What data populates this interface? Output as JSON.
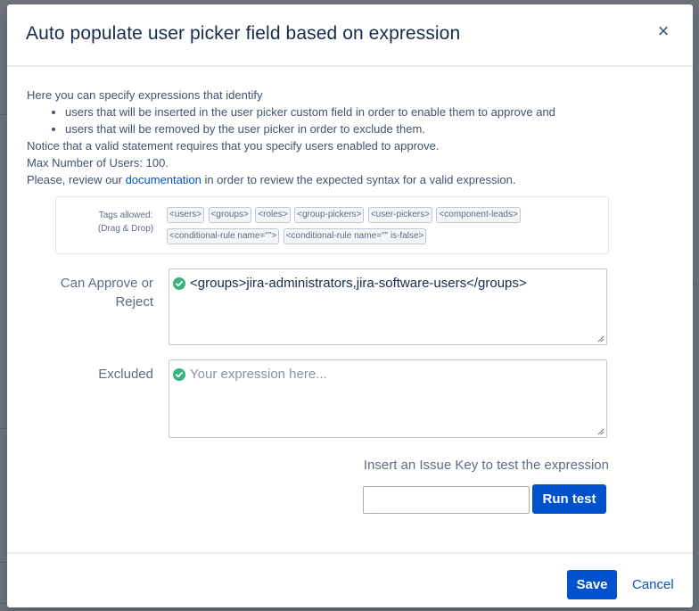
{
  "dialog": {
    "title": "Auto populate user picker field based on expression",
    "close_label": "×"
  },
  "intro": {
    "line1": "Here you can specify expressions that identify",
    "bullets": [
      "users that will be inserted in the user picker custom field in order to enable them to approve and",
      "users that will be removed by the user picker in order to exclude them."
    ],
    "line2": "Notice that a valid statement requires that you specify users enabled to approve.",
    "line3": "Max Number of Users: 100.",
    "line4_before": "Please, review our ",
    "line4_link": "documentation",
    "line4_after": " in order to review the expected syntax for a valid expression."
  },
  "tags": {
    "label_line1": "Tags allowed:",
    "label_line2": "(Drag & Drop)",
    "items": [
      "<users>",
      "<groups>",
      "<roles>",
      "<group-pickers>",
      "<user-pickers>",
      "<component-leads>",
      "<conditional-rule name=\"\">",
      "<conditional-rule name=\"\" is-false>"
    ]
  },
  "approve_field": {
    "label_line1": "Can Approve or",
    "label_line2": "Reject",
    "value": "<groups>jira-administrators,jira-software-users</groups>",
    "icon": "check-circle-icon"
  },
  "excluded_field": {
    "label": "Excluded",
    "placeholder": "Your expression here...",
    "icon": "check-circle-icon"
  },
  "test": {
    "label": "Insert an Issue Key to test the expression",
    "input_value": "",
    "button_label": "Run test"
  },
  "footer": {
    "save_label": "Save",
    "cancel_label": "Cancel"
  },
  "colors": {
    "primary": "#0052cc",
    "valid": "#36b37e",
    "label": "#5e6c84"
  }
}
